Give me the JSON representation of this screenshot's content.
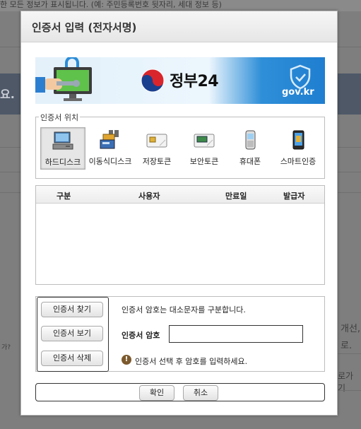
{
  "background": {
    "top_text": "한 모든 정보가 표시됩니다. (예: 주민등록번호 뒷자리, 세대 정보 등)",
    "band_text": "요.",
    "right_text_1": "개선,",
    "right_text_2": "로.",
    "right_text_3": "로가기",
    "left_text": "가?"
  },
  "modal": {
    "title": "인증서 입력 (전자서명)"
  },
  "banner": {
    "service_name": "정부24",
    "domain_label": "gov.kr"
  },
  "location": {
    "legend": "인증서 위치",
    "items": [
      {
        "label": "하드디스크",
        "icon": "hard-disk-icon",
        "selected": true
      },
      {
        "label": "이동식디스크",
        "icon": "removable-disk-icon",
        "selected": false
      },
      {
        "label": "저장토큰",
        "icon": "storage-token-icon",
        "selected": false
      },
      {
        "label": "보안토큰",
        "icon": "security-token-icon",
        "selected": false
      },
      {
        "label": "휴대폰",
        "icon": "mobile-phone-icon",
        "selected": false
      },
      {
        "label": "스마트인증",
        "icon": "smart-auth-icon",
        "selected": false
      }
    ]
  },
  "cert_table": {
    "columns": [
      "구분",
      "사용자",
      "만료일",
      "발급자"
    ],
    "rows": []
  },
  "actions": {
    "find_cert": "인증서 찾기",
    "view_cert": "인증서 보기",
    "delete_cert": "인증서 삭제"
  },
  "password": {
    "info": "인증서 암호는 대소문자를 구분합니다.",
    "label": "인증서 암호",
    "value": "",
    "hint": "인증서 선택 후 암호를 입력하세요."
  },
  "footer": {
    "ok": "확인",
    "cancel": "취소"
  },
  "colors": {
    "banner_blue": "#1f7ed0",
    "warn_brown": "#7c5a2d"
  }
}
